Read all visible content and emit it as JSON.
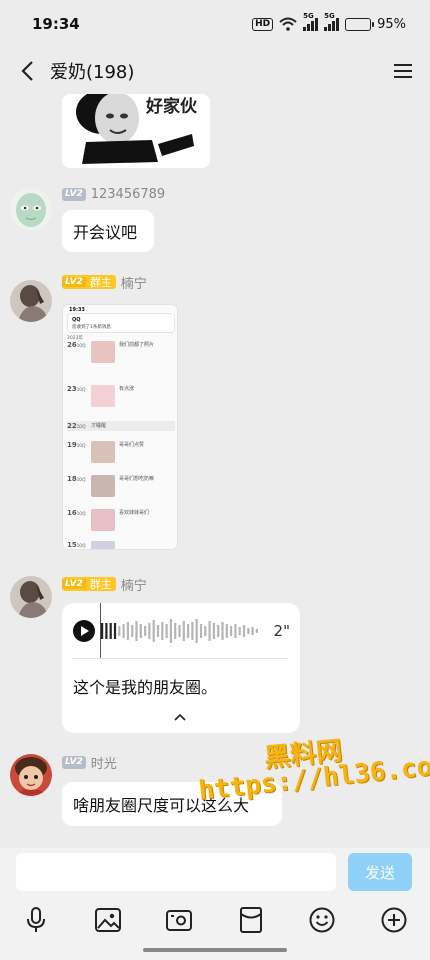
{
  "status_bar": {
    "time": "19:34",
    "hd": "HD",
    "net1": "5G",
    "net2": "5G",
    "battery": "95%",
    "battery_level": 0.95
  },
  "header": {
    "title": "爱奶(198)",
    "back_icon": "back-arrow-icon",
    "menu_icon": "hamburger-menu-icon"
  },
  "messages": [
    {
      "type": "sticker",
      "sticker_text": "好家伙"
    },
    {
      "type": "text",
      "level": "LV2",
      "sender": "123456789",
      "text": "开会议吧",
      "avatar_color": "#b9d9c4"
    },
    {
      "type": "image",
      "level": "LV2",
      "role": "群主",
      "sender": "楠宁",
      "avatar_color": "#8a7a75",
      "image": {
        "time": "19:33",
        "title": "QQ",
        "subtitle": "您收到了1条新消息",
        "section": "2023年",
        "rows": [
          {
            "date": "26",
            "month": "10月",
            "caption": "我们前都了照片"
          },
          {
            "date": "23",
            "month": "10月",
            "caption": "有点涨"
          },
          {
            "date": "22",
            "month": "10月",
            "caption": "才睡醒"
          },
          {
            "date": "19",
            "month": "10月",
            "caption": "哥哥们点赞"
          },
          {
            "date": "18",
            "month": "10月",
            "caption": "哥哥们想吃奶嘛"
          },
          {
            "date": "16",
            "month": "10月",
            "caption": "喜欢妹妹哥们"
          },
          {
            "date": "15",
            "month": "10月",
            "caption": ""
          }
        ]
      }
    },
    {
      "type": "voice",
      "level": "LV2",
      "role": "群主",
      "sender": "楠宁",
      "avatar_color": "#8a7a75",
      "duration": "2\"",
      "transcript": "这个是我的朋友圈。"
    },
    {
      "type": "text",
      "level": "LV2",
      "sender": "时光",
      "text": "啥朋友圈尺度可以这么大",
      "avatar_color": "#b8322c"
    }
  ],
  "watermark": {
    "line1": "黑料网",
    "line2": "https://hl36.co"
  },
  "input": {
    "placeholder": "",
    "send_label": "发送"
  },
  "toolbar": {
    "icons": [
      "microphone-icon",
      "image-icon",
      "camera-icon",
      "red-packet-icon",
      "emoji-icon",
      "plus-icon"
    ]
  },
  "colors": {
    "background": "#ececec",
    "send_button": "#8ed0f7",
    "owner_badge": "#ffc726",
    "level_badge": "#b7bccb"
  }
}
